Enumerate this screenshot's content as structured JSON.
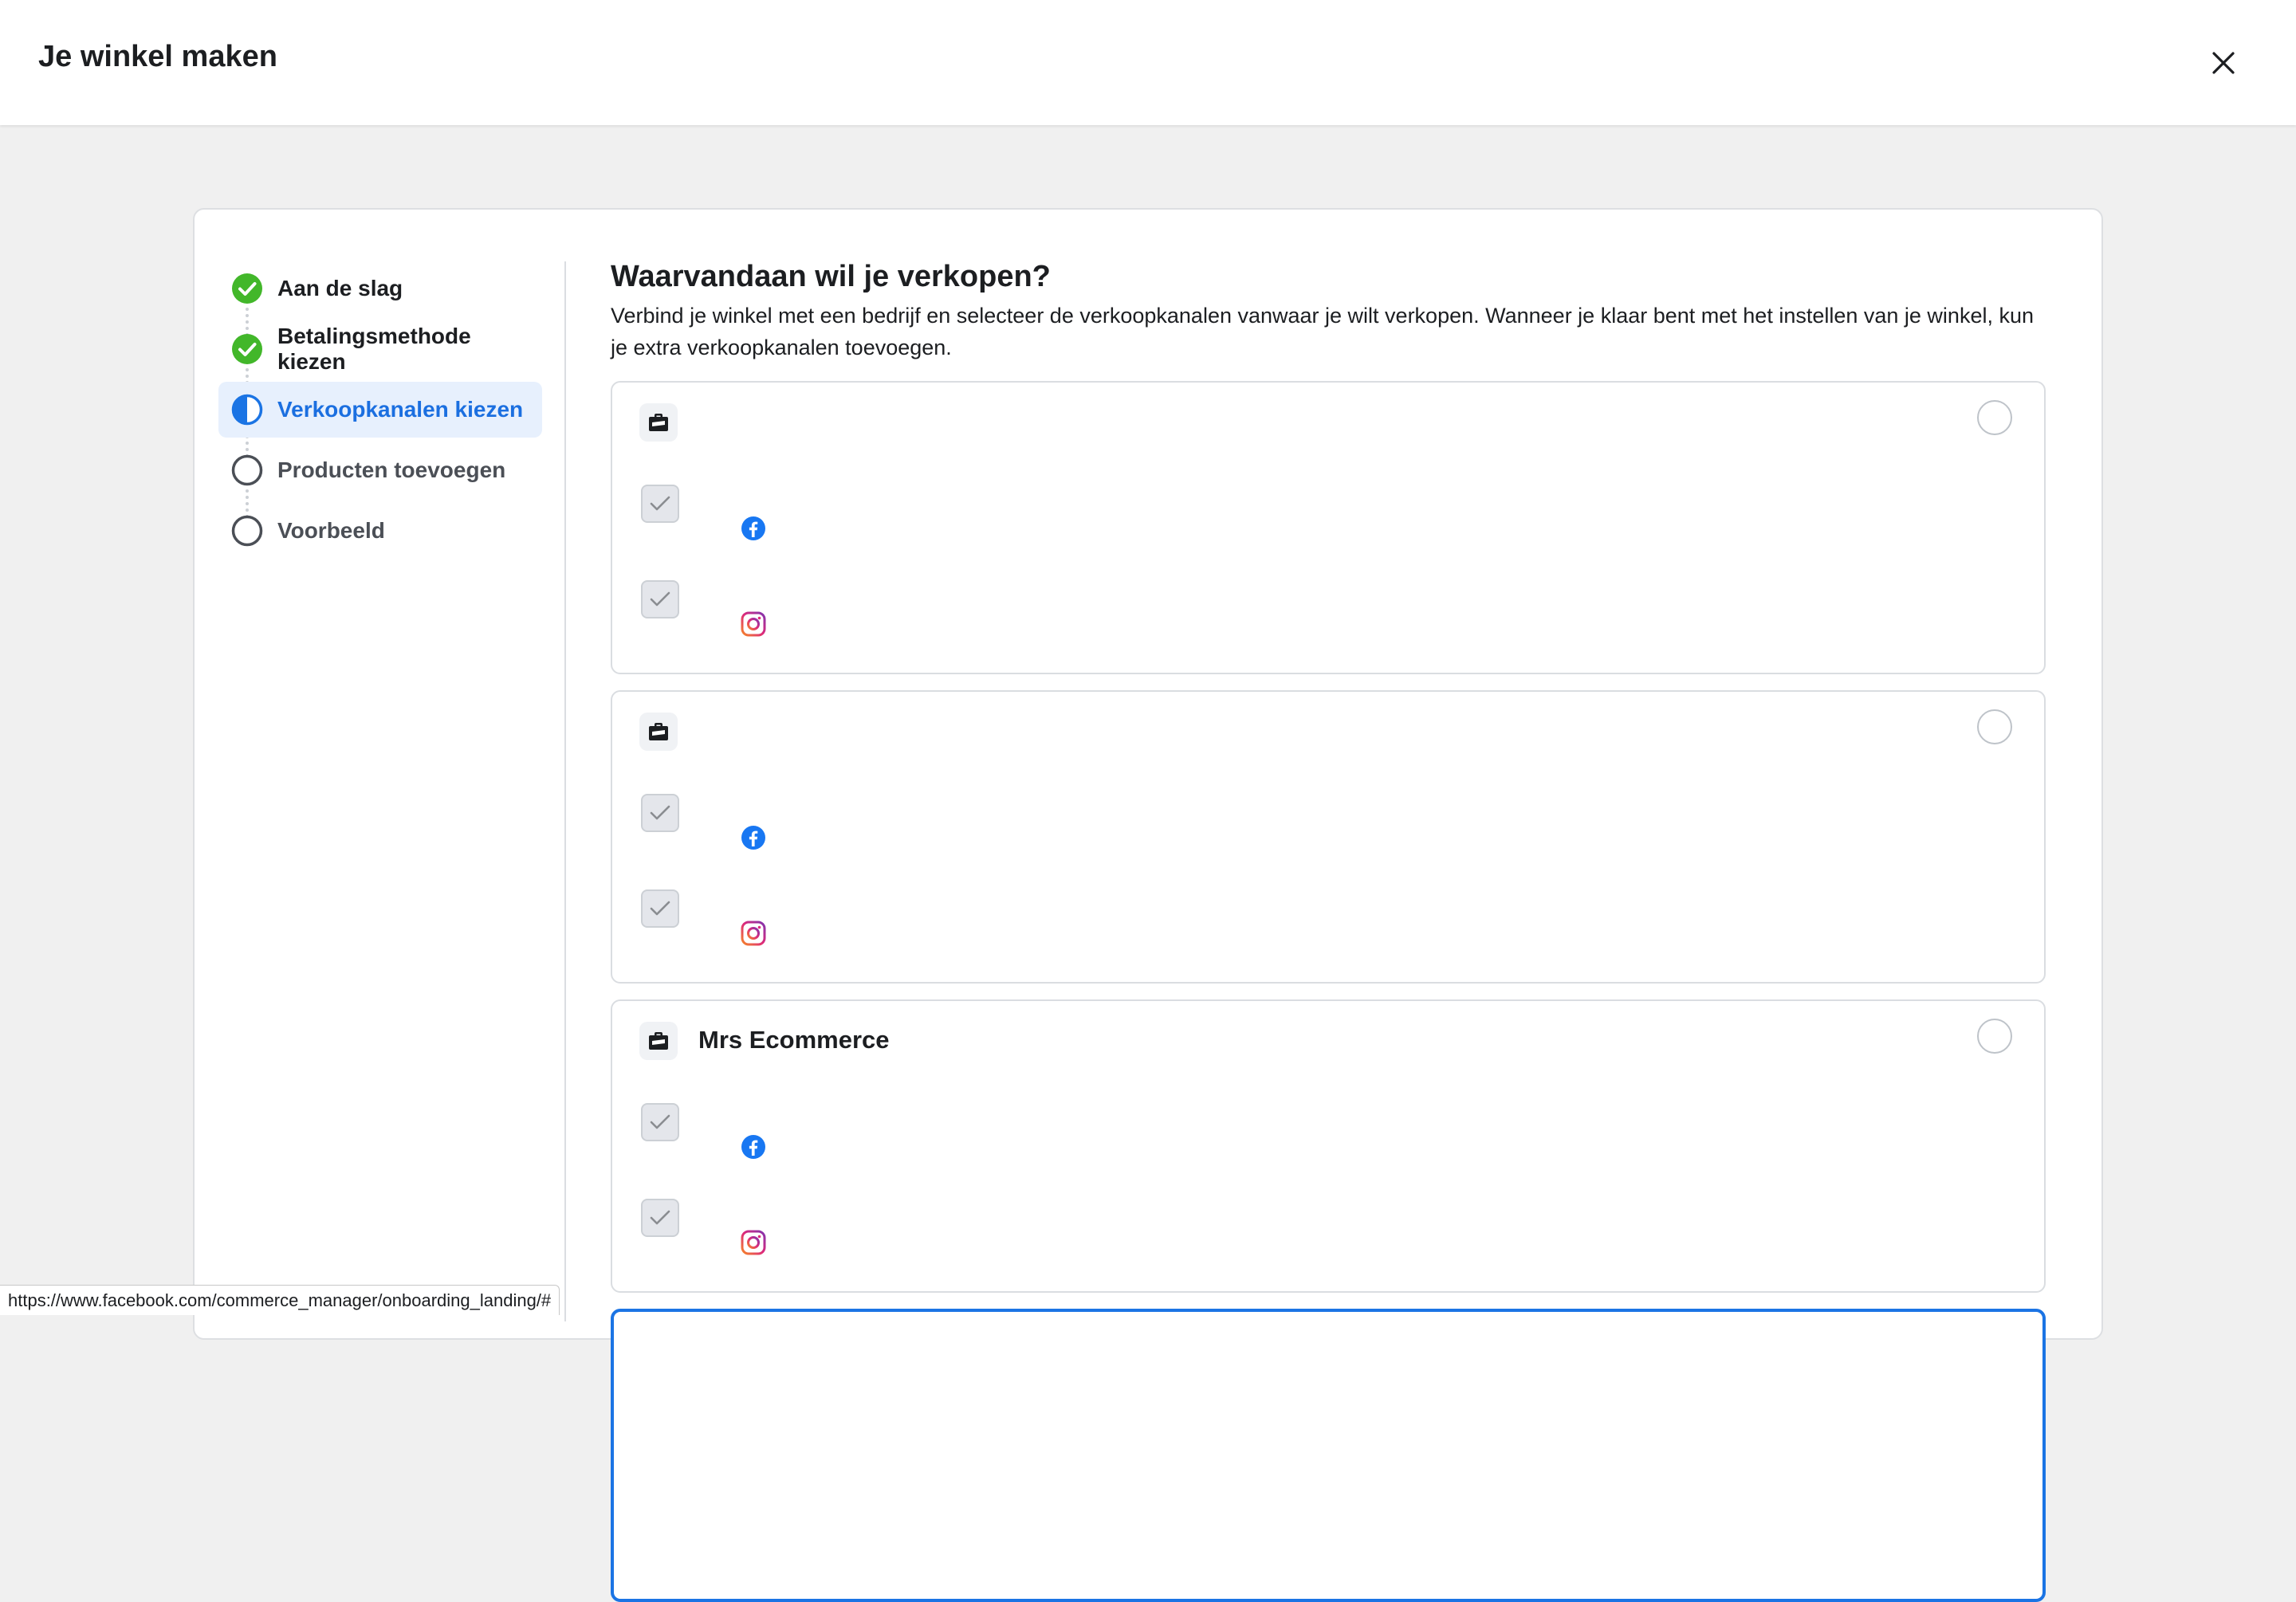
{
  "header": {
    "title": "Je winkel maken",
    "close_icon": "close-icon"
  },
  "steps": [
    {
      "label": "Aan de slag",
      "status": "done"
    },
    {
      "label": "Betalingsmethode kiezen",
      "status": "done"
    },
    {
      "label": "Verkoopkanalen kiezen",
      "status": "current"
    },
    {
      "label": "Producten toevoegen",
      "status": "todo"
    },
    {
      "label": "Voorbeeld",
      "status": "todo"
    }
  ],
  "main": {
    "heading": "Waarvandaan wil je verkopen?",
    "description": "Verbind je winkel met een bedrijf en selecteer de verkoopkanalen vanwaar je wilt verkopen. Wanneer je klaar bent met het instellen van je winkel, kun je extra verkoopkanalen toevoegen.",
    "businesses": [
      {
        "name": "",
        "channels": [
          "facebook-icon",
          "instagram-icon"
        ],
        "selected": false
      },
      {
        "name": "",
        "channels": [
          "facebook-icon",
          "instagram-icon"
        ],
        "selected": false
      },
      {
        "name": "Mrs Ecommerce",
        "channels": [
          "facebook-icon",
          "instagram-icon"
        ],
        "selected": false
      }
    ]
  },
  "statusbar": {
    "url": "https://www.facebook.com/commerce_manager/onboarding_landing/#"
  },
  "colors": {
    "accent": "#1b74e4",
    "done_green": "#42b72a",
    "active_bg": "#e7f0fd"
  }
}
